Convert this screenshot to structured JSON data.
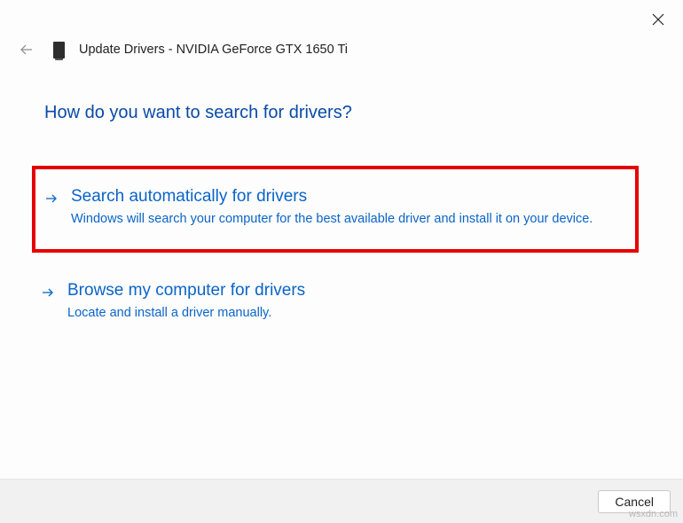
{
  "header": {
    "title": "Update Drivers - NVIDIA GeForce GTX 1650 Ti"
  },
  "main": {
    "heading": "How do you want to search for drivers?",
    "options": [
      {
        "title": "Search automatically for drivers",
        "description": "Windows will search your computer for the best available driver and install it on your device."
      },
      {
        "title": "Browse my computer for drivers",
        "description": "Locate and install a driver manually."
      }
    ]
  },
  "footer": {
    "cancel": "Cancel"
  },
  "watermark": "wsxdn.com"
}
